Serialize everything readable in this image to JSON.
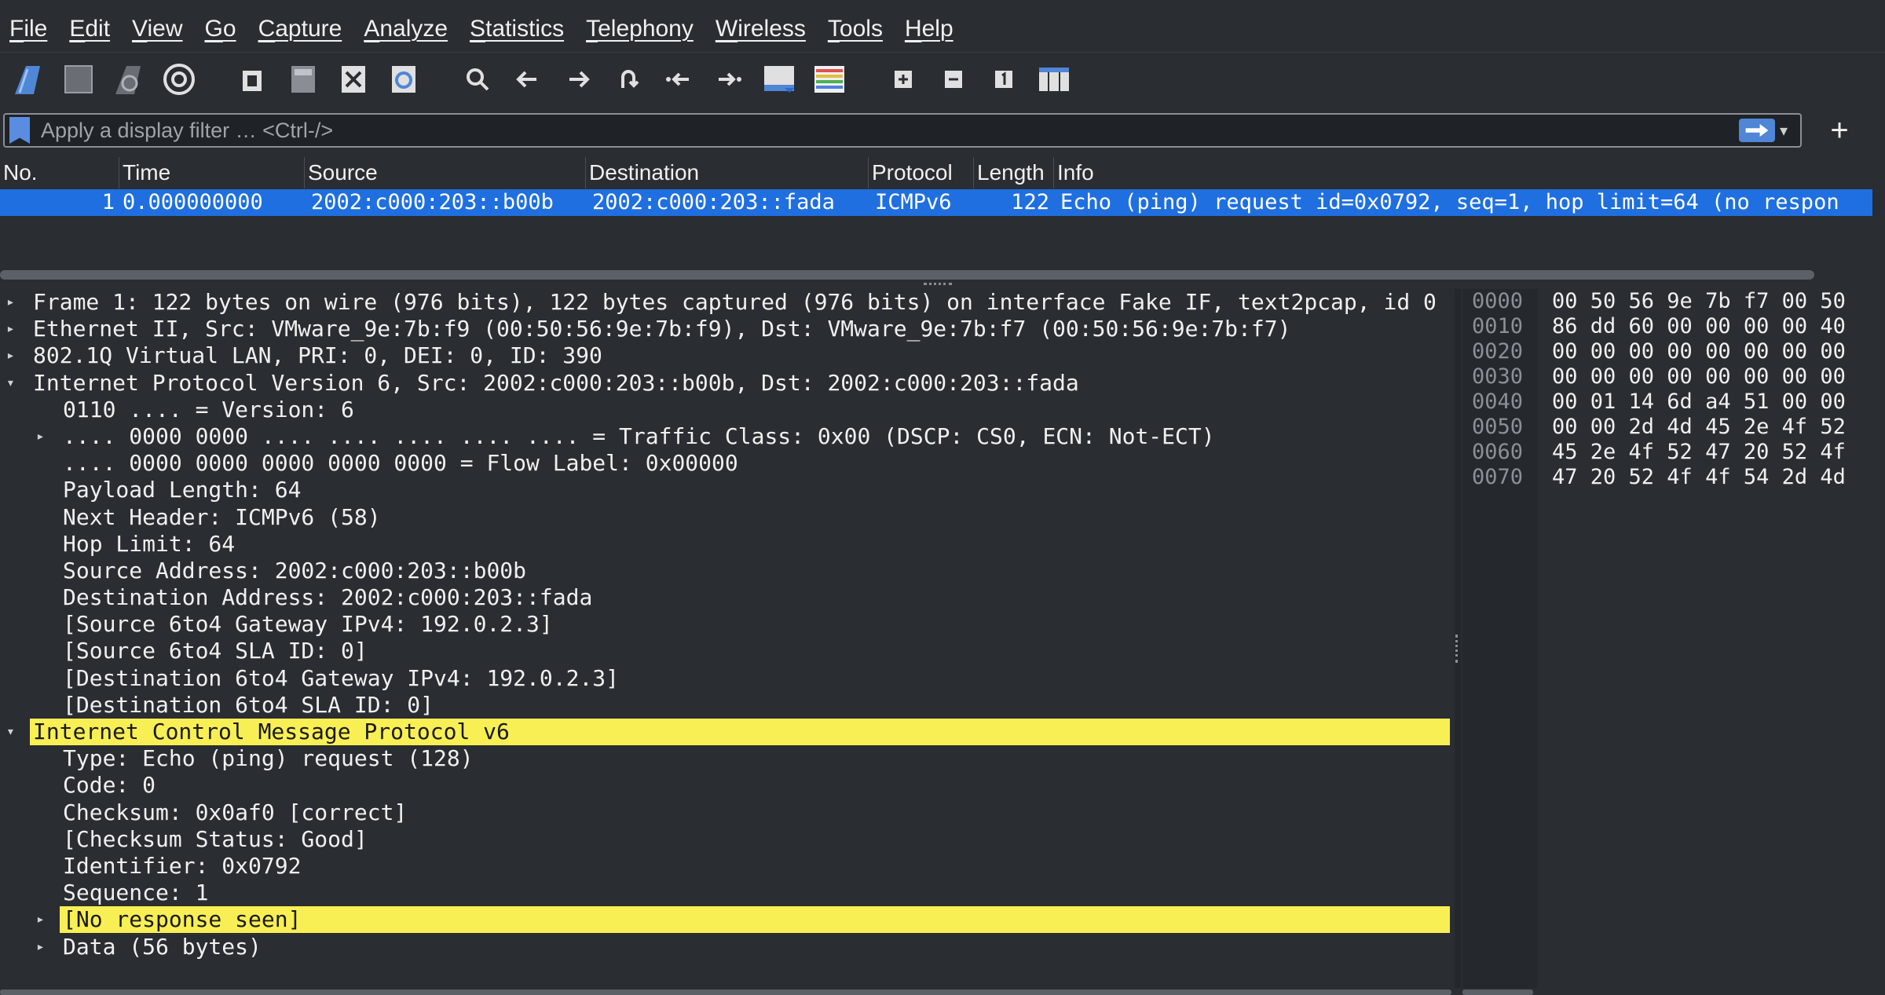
{
  "menu": [
    "File",
    "Edit",
    "View",
    "Go",
    "Capture",
    "Analyze",
    "Statistics",
    "Telephony",
    "Wireless",
    "Tools",
    "Help"
  ],
  "filter": {
    "placeholder": "Apply a display filter … <Ctrl-/>"
  },
  "packet_list": {
    "headers": [
      "No.",
      "Time",
      "Source",
      "Destination",
      "Protocol",
      "Length",
      "Info"
    ],
    "rows": [
      {
        "no": "1",
        "time": "0.000000000",
        "source": "2002:c000:203::b00b",
        "destination": "2002:c000:203::fada",
        "protocol": "ICMPv6",
        "length": "122",
        "info": "Echo (ping) request id=0x0792, seq=1, hop limit=64 (no respon"
      }
    ]
  },
  "details": [
    {
      "text": "Frame 1: 122 bytes on wire (976 bits), 122 bytes captured (976 bits) on interface Fake IF, text2pcap, id 0",
      "level": 0,
      "arrow": "collapsed",
      "highlight": false
    },
    {
      "text": "Ethernet II, Src: VMware_9e:7b:f9 (00:50:56:9e:7b:f9), Dst: VMware_9e:7b:f7 (00:50:56:9e:7b:f7)",
      "level": 0,
      "arrow": "collapsed",
      "highlight": false
    },
    {
      "text": "802.1Q Virtual LAN, PRI: 0, DEI: 0, ID: 390",
      "level": 0,
      "arrow": "collapsed",
      "highlight": false
    },
    {
      "text": "Internet Protocol Version 6, Src: 2002:c000:203::b00b, Dst: 2002:c000:203::fada",
      "level": 0,
      "arrow": "expanded",
      "highlight": false
    },
    {
      "text": "0110 .... = Version: 6",
      "level": 1,
      "arrow": "none",
      "highlight": false
    },
    {
      "text": ".... 0000 0000 .... .... .... .... .... = Traffic Class: 0x00 (DSCP: CS0, ECN: Not-ECT)",
      "level": 1,
      "arrow": "collapsed",
      "highlight": false
    },
    {
      "text": ".... 0000 0000 0000 0000 0000 = Flow Label: 0x00000",
      "level": 1,
      "arrow": "none",
      "highlight": false
    },
    {
      "text": "Payload Length: 64",
      "level": 1,
      "arrow": "none",
      "highlight": false
    },
    {
      "text": "Next Header: ICMPv6 (58)",
      "level": 1,
      "arrow": "none",
      "highlight": false
    },
    {
      "text": "Hop Limit: 64",
      "level": 1,
      "arrow": "none",
      "highlight": false
    },
    {
      "text": "Source Address: 2002:c000:203::b00b",
      "level": 1,
      "arrow": "none",
      "highlight": false
    },
    {
      "text": "Destination Address: 2002:c000:203::fada",
      "level": 1,
      "arrow": "none",
      "highlight": false
    },
    {
      "text": "[Source 6to4 Gateway IPv4: 192.0.2.3]",
      "level": 1,
      "arrow": "none",
      "highlight": false
    },
    {
      "text": "[Source 6to4 SLA ID: 0]",
      "level": 1,
      "arrow": "none",
      "highlight": false
    },
    {
      "text": "[Destination 6to4 Gateway IPv4: 192.0.2.3]",
      "level": 1,
      "arrow": "none",
      "highlight": false
    },
    {
      "text": "[Destination 6to4 SLA ID: 0]",
      "level": 1,
      "arrow": "none",
      "highlight": false
    },
    {
      "text": "Internet Control Message Protocol v6",
      "level": 0,
      "arrow": "expanded",
      "highlight": true
    },
    {
      "text": "Type: Echo (ping) request (128)",
      "level": 1,
      "arrow": "none",
      "highlight": false
    },
    {
      "text": "Code: 0",
      "level": 1,
      "arrow": "none",
      "highlight": false
    },
    {
      "text": "Checksum: 0x0af0 [correct]",
      "level": 1,
      "arrow": "none",
      "highlight": false
    },
    {
      "text": "[Checksum Status: Good]",
      "level": 1,
      "arrow": "none",
      "highlight": false
    },
    {
      "text": "Identifier: 0x0792",
      "level": 1,
      "arrow": "none",
      "highlight": false
    },
    {
      "text": "Sequence: 1",
      "level": 1,
      "arrow": "none",
      "highlight": false
    },
    {
      "text": "[No response seen]",
      "level": 1,
      "arrow": "collapsed",
      "highlight": true
    },
    {
      "text": "Data (56 bytes)",
      "level": 1,
      "arrow": "collapsed",
      "highlight": false
    }
  ],
  "hex": {
    "offsets": [
      "0000",
      "0010",
      "0020",
      "0030",
      "0040",
      "0050",
      "0060",
      "0070"
    ],
    "bytes": [
      "00 50 56 9e 7b f7 00 50",
      "86 dd 60 00 00 00 00 40",
      "00 00 00 00 00 00 00 00",
      "00 00 00 00 00 00 00 00",
      "00 01 14 6d a4 51 00 00",
      "00 00 2d 4d 45 2e 4f 52",
      "45 2e 4f 52 47 20 52 4f",
      "47 20 52 4f 4f 54 2d 4d"
    ]
  },
  "colors": {
    "selected_row": "#1f6fe0",
    "highlight": "#f8ef55",
    "background": "#2a2d31"
  }
}
